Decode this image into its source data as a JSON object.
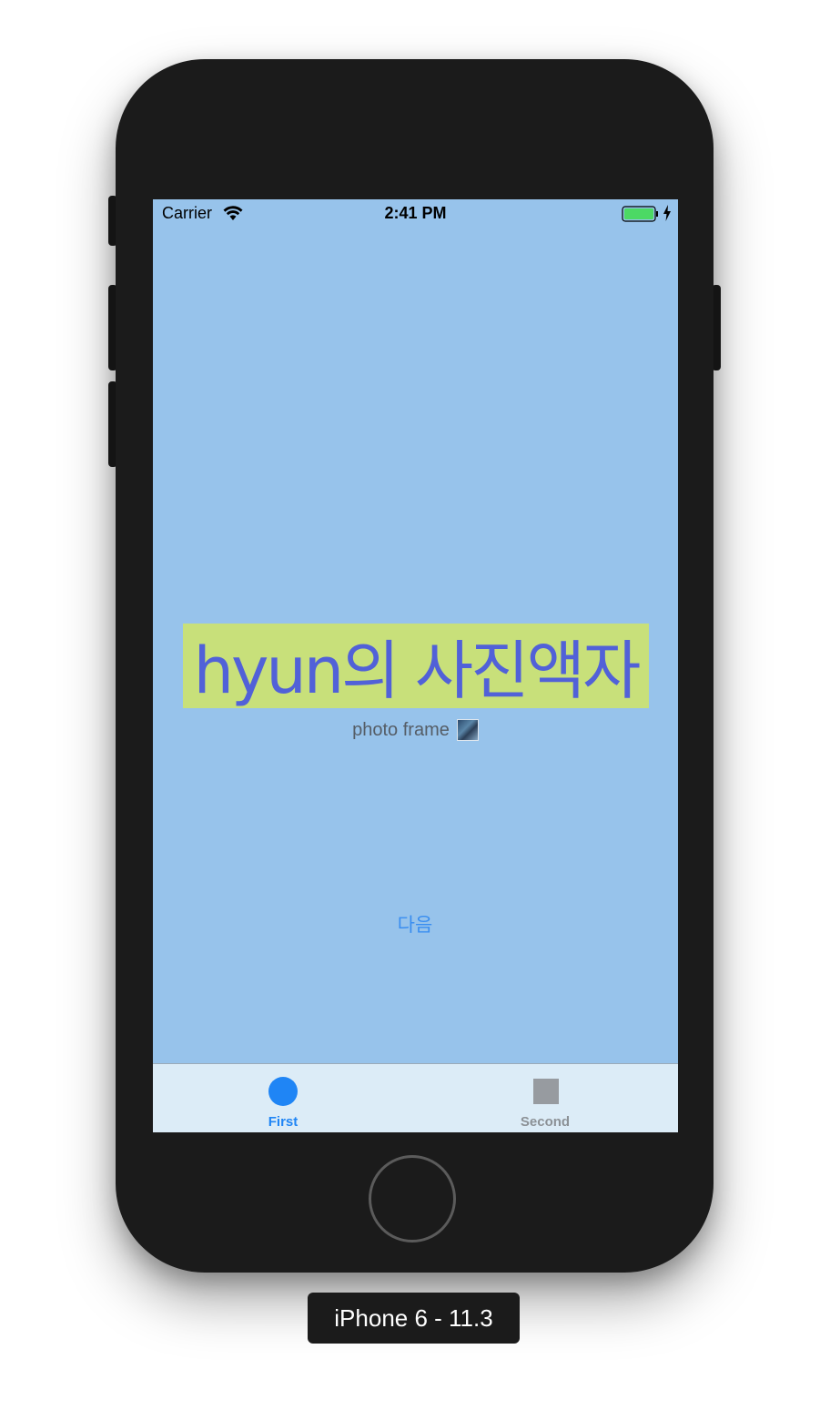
{
  "statusbar": {
    "carrier": "Carrier",
    "time": "2:41 PM",
    "icons": [
      "wifi-icon",
      "battery-icon",
      "charging-bolt-icon"
    ]
  },
  "main": {
    "title": "hyun의 사진액자",
    "subtitle": "photo frame",
    "next_button": "다음"
  },
  "tabbar": {
    "tabs": [
      {
        "label": "First",
        "icon": "circle-icon",
        "selected": true
      },
      {
        "label": "Second",
        "icon": "square-icon",
        "selected": false
      }
    ]
  },
  "device": {
    "label": "iPhone 6 - 11.3"
  },
  "colors": {
    "screen_background": "#97c3eb",
    "title_background": "#c8e07a",
    "title_text": "#5161d8",
    "accent": "#1f85f5",
    "tab_inactive": "#979ba0",
    "battery": "#4cd964"
  }
}
